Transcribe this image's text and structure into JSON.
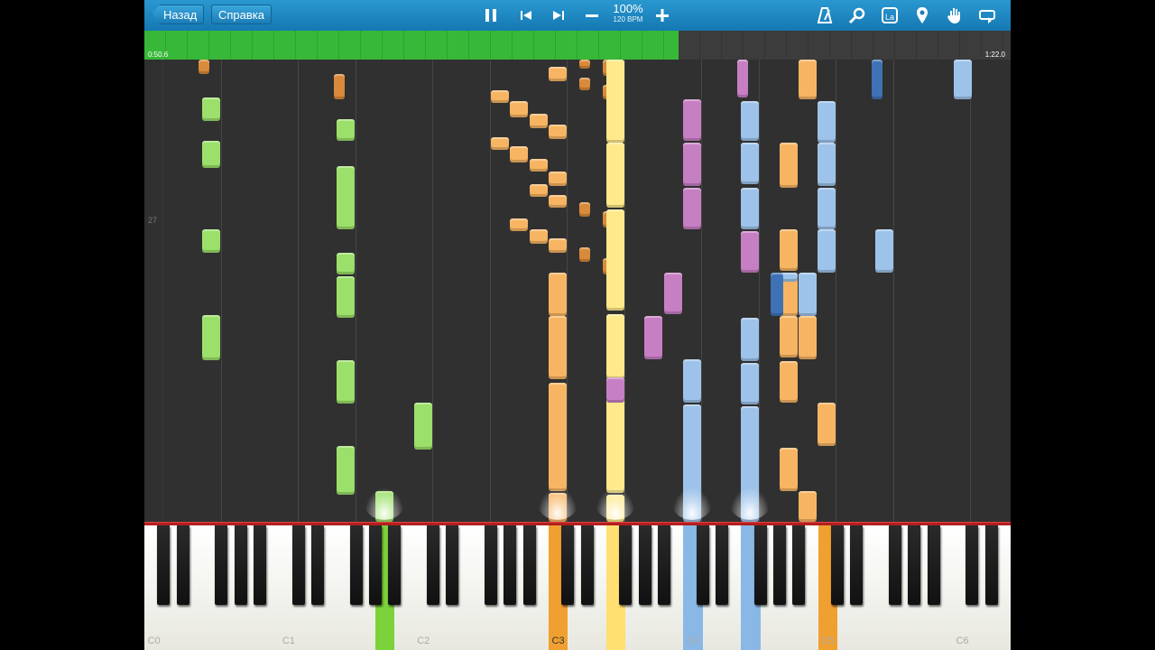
{
  "toolbar": {
    "back_label": "Назад",
    "help_label": "Справка",
    "speed_percent": "100%",
    "tempo": "120 BPM",
    "icons": [
      "pause-icon",
      "skip-back-icon",
      "skip-forward-icon",
      "minus-icon",
      "plus-icon",
      "metronome-icon",
      "zoom-icon",
      "note-label-icon",
      "marker-icon",
      "hand-icon",
      "loop-icon"
    ],
    "note_label_text": "La"
  },
  "progress": {
    "current_time": "0:50.6",
    "total_time": "1:22.0",
    "fraction": 0.617
  },
  "piano_roll": {
    "measure_number": "27",
    "colors": {
      "left_hand_green": "#9be06a",
      "orange": "#f7b563",
      "yellow": "#ffe98a",
      "violet": "#c77fc4",
      "blue": "#9ec3ea",
      "dark_blue": "#3f72b5"
    }
  },
  "keyboard": {
    "octave_labels": [
      "C0",
      "C1",
      "C2",
      "C3",
      "C4",
      "C5",
      "C6"
    ],
    "highlight_colors": {
      "green": "#7cd23a",
      "orange": "#f0a030",
      "yellow": "#ffe070",
      "blue": "#8ab8e6"
    }
  }
}
